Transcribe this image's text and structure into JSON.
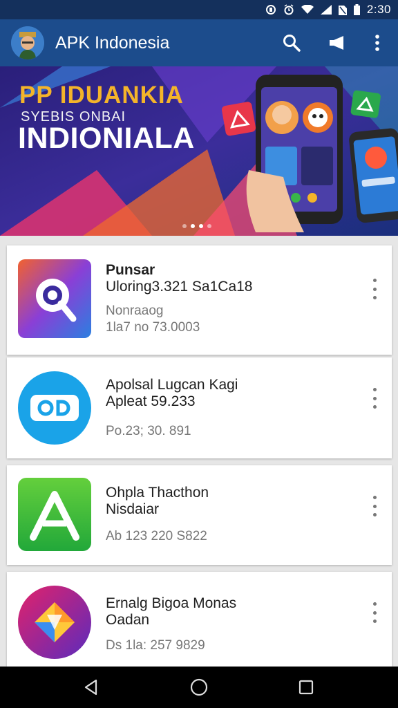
{
  "status_bar": {
    "time": "2:30"
  },
  "app_bar": {
    "title": "APK Indonesia"
  },
  "banner": {
    "line1": "PP IDUANKIA",
    "line2": "SYEBIS ONBAI",
    "line3": "INDIONIALA",
    "slides": 4,
    "active_slide": 2
  },
  "apps": [
    {
      "name": "Punsar",
      "meta1": "Uloring3.321 Sa1Ca18",
      "meta2": "Nonraaog",
      "meta3": "1la7 no 73.0003"
    },
    {
      "name": "Apolsal Lugcan Kagi",
      "meta1": "Apleat 59.233",
      "meta2": "",
      "meta3": "Po.23; 30. 891"
    },
    {
      "name": "Ohpla Thacthon",
      "meta1": "Nisdaiar",
      "meta2": "",
      "meta3": "Ab 123 220 S822"
    },
    {
      "name": "Ernalg Bigoa Monas",
      "meta1": "Oadan",
      "meta2": "",
      "meta3": "Ds 1la: 257 9829"
    }
  ]
}
